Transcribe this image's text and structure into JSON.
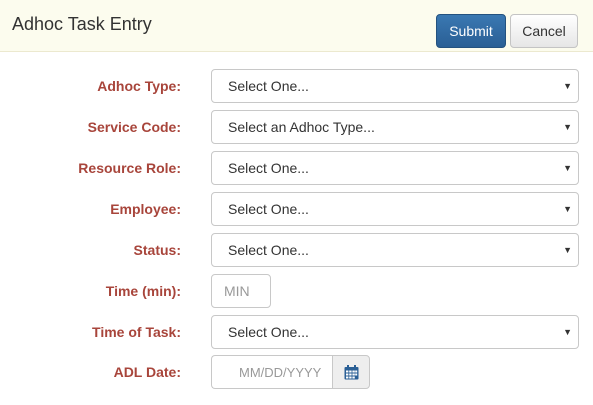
{
  "header": {
    "title": "Adhoc Task Entry",
    "submit_label": "Submit",
    "cancel_label": "Cancel"
  },
  "form": {
    "adhoc_type": {
      "label": "Adhoc Type:",
      "value": "Select One..."
    },
    "service_code": {
      "label": "Service Code:",
      "value": "Select an Adhoc Type..."
    },
    "resource_role": {
      "label": "Resource Role:",
      "value": "Select One..."
    },
    "employee": {
      "label": "Employee:",
      "value": "Select One..."
    },
    "status": {
      "label": "Status:",
      "value": "Select One..."
    },
    "time_min": {
      "label": "Time (min):",
      "placeholder": "MIN"
    },
    "time_of_task": {
      "label": "Time of Task:",
      "value": "Select One..."
    },
    "adl_date": {
      "label": "ADL Date:",
      "placeholder": "MM/DD/YYYY",
      "icon": "calendar-icon"
    }
  },
  "colors": {
    "header_bg": "#fcfcee",
    "label": "#a8453b",
    "submit_bg": "#2f6ba3"
  }
}
